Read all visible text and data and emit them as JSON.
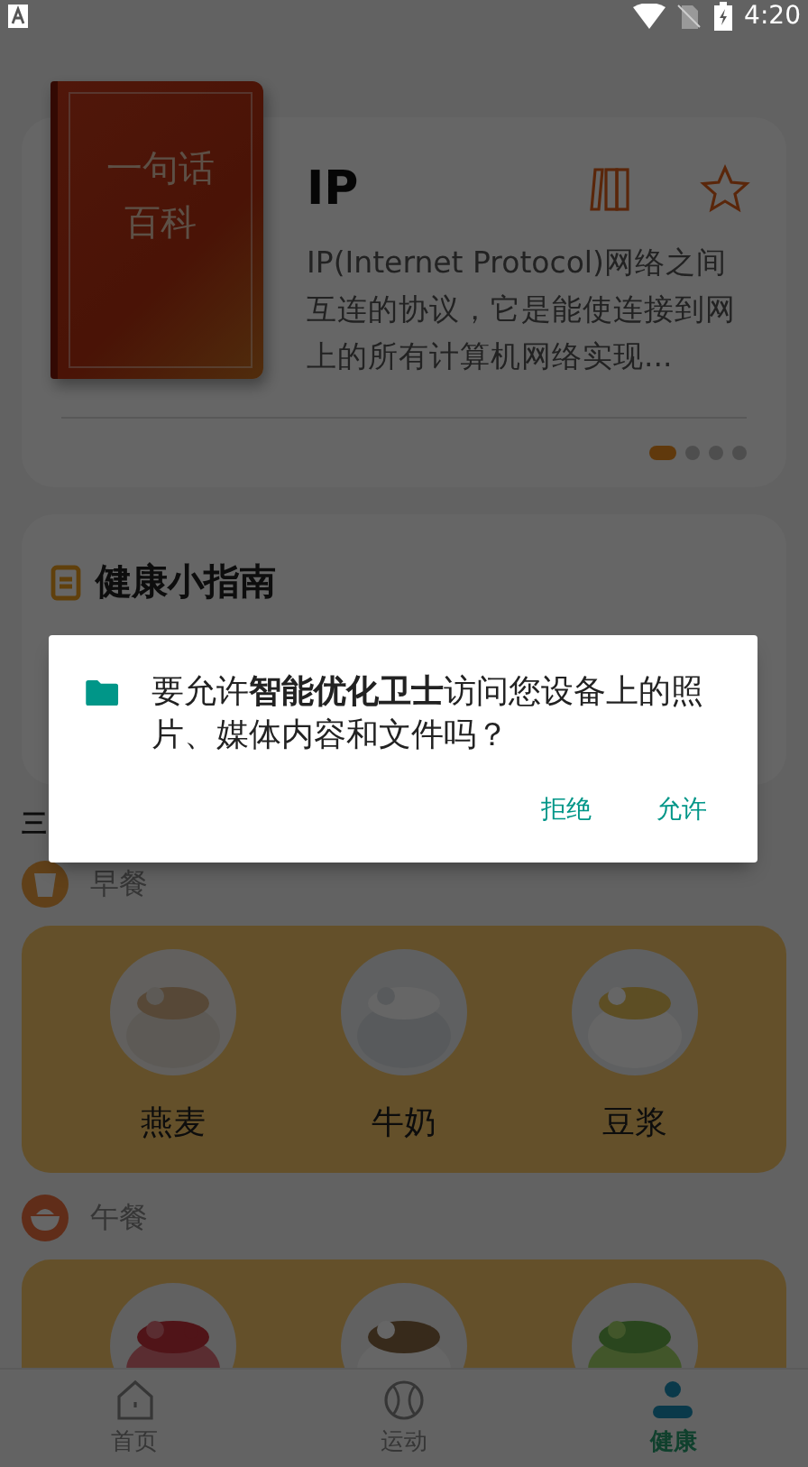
{
  "status_bar": {
    "time": "4:20"
  },
  "quote_card": {
    "cover_lines": [
      "一句话",
      "百科"
    ],
    "title": "IP",
    "description": "IP(Internet Protocol)网络之间互连的协议，它是能使连接到网上的所有计算机网络实现...",
    "pages": [
      {
        "selected": true
      },
      {
        "selected": false
      },
      {
        "selected": false
      },
      {
        "selected": false
      }
    ]
  },
  "guide": {
    "title": "健康小指南"
  },
  "meals_heading": "三",
  "meals": [
    {
      "name": "早餐",
      "kind": "cup",
      "foods": [
        {
          "kind": "picture",
          "name": "燕麦"
        },
        {
          "kind": "picture",
          "name": "牛奶"
        },
        {
          "kind": "picture",
          "name": "豆浆"
        }
      ]
    },
    {
      "name": "午餐",
      "kind": "bowl"
    }
  ],
  "nav": [
    {
      "label": "首页",
      "kind": "home",
      "selected": false
    },
    {
      "label": "运动",
      "kind": "ball",
      "selected": false
    },
    {
      "label": "健康",
      "kind": "person",
      "selected": true
    }
  ],
  "dialog": {
    "message": "要允许**智能优化卫士**访问您设备上的照片、媒体内容和文件吗？",
    "buttons": [
      "拒绝",
      "允许"
    ]
  }
}
